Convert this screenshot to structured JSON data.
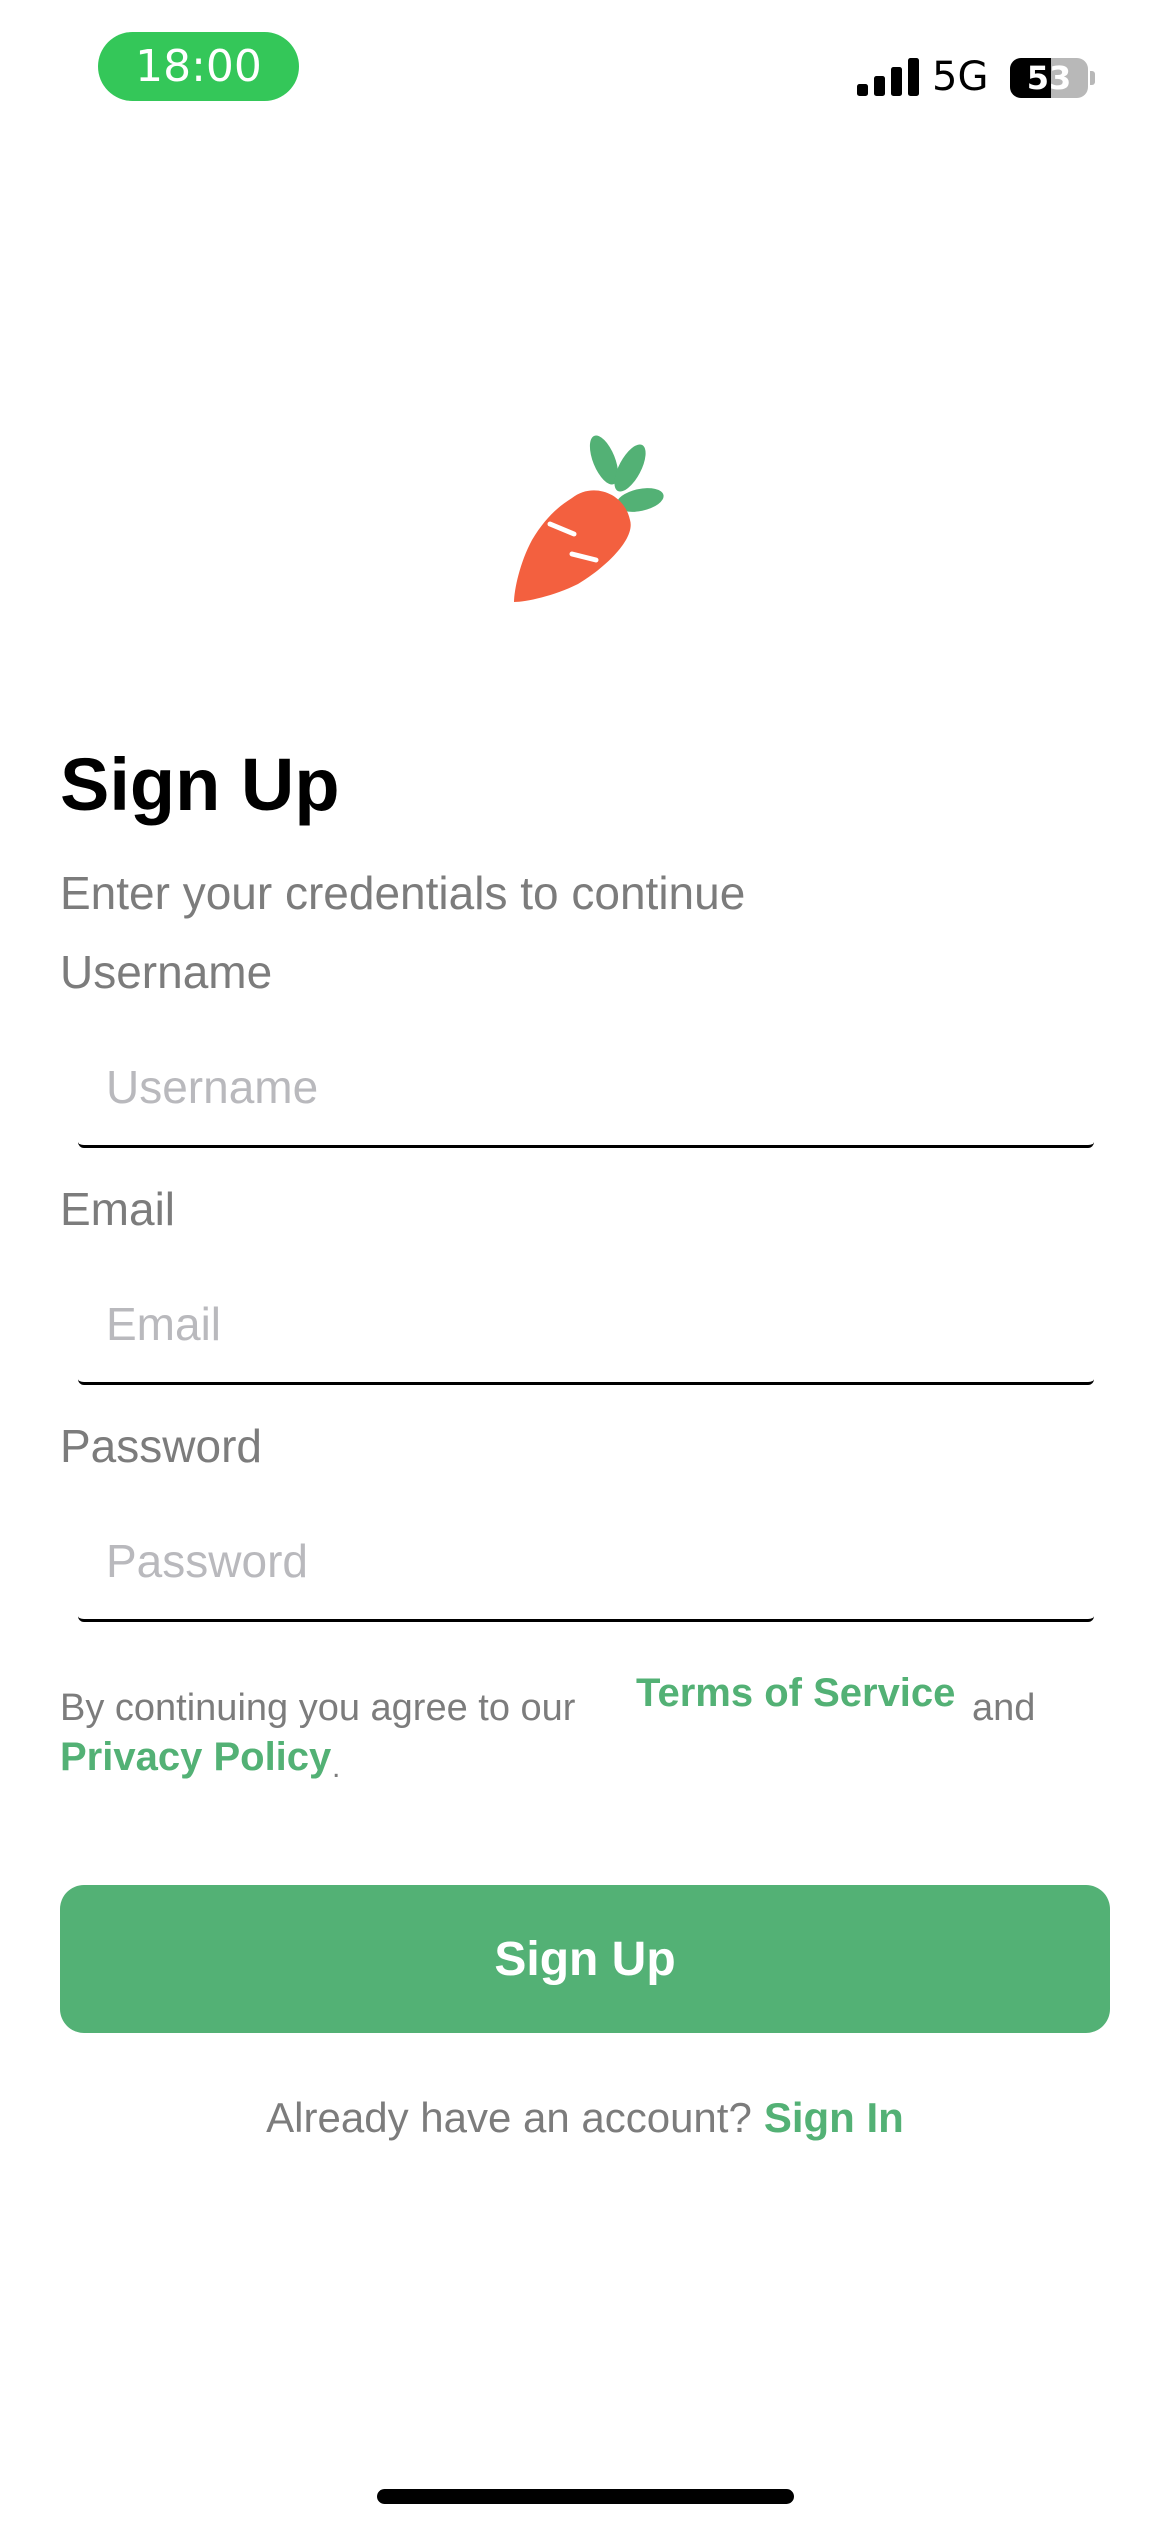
{
  "status_bar": {
    "time": "18:00",
    "network": "5G",
    "battery_level": "53",
    "battery_fraction": 0.53,
    "time_pill_color": "#34c759"
  },
  "logo": {
    "icon": "carrot-icon",
    "body_color": "#f3603f",
    "leaf_color": "#53b175"
  },
  "header": {
    "title": "Sign Up",
    "subtitle": "Enter your credentials to continue"
  },
  "form": {
    "username": {
      "label": "Username",
      "placeholder": "Username",
      "value": ""
    },
    "email": {
      "label": "Email",
      "placeholder": "Email",
      "value": ""
    },
    "password": {
      "label": "Password",
      "placeholder": "Password",
      "value": ""
    }
  },
  "terms": {
    "prefix": "By continuing you agree to our",
    "terms_link": "Terms of Service",
    "conjunction": "and",
    "privacy_link": "Privacy Policy",
    "suffix": "."
  },
  "actions": {
    "signup_label": "Sign Up"
  },
  "footer": {
    "question": "Already have an account?",
    "signin_link": "Sign In"
  },
  "colors": {
    "accent": "#53b175",
    "muted_text": "#7c7c7c",
    "placeholder": "#b9b9bd"
  }
}
